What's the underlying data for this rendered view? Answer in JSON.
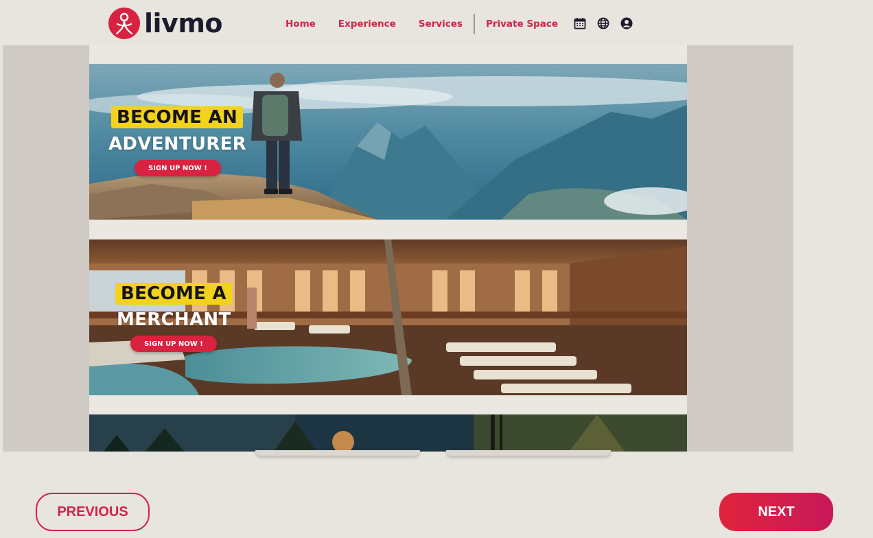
{
  "header": {
    "logo_text": "livmo",
    "nav": [
      "Home",
      "Experience",
      "Services",
      "Private Space"
    ],
    "icons": [
      "calendar-icon",
      "globe-icon",
      "user-icon"
    ],
    "brand_color": "#d0234a"
  },
  "banners": [
    {
      "line1": "BECOME AN",
      "line2": "ADVENTURER",
      "cta": "SIGN UP NOW !"
    },
    {
      "line1": "BECOME A",
      "line2": "MERCHANT",
      "cta": "SIGN UP NOW !"
    }
  ],
  "footer": {
    "previous": "PREVIOUS",
    "next": "NEXT"
  }
}
